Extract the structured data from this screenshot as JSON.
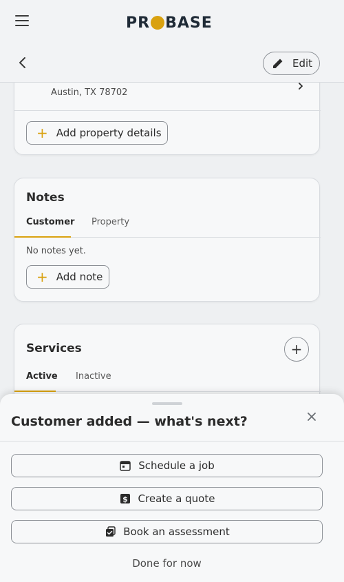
{
  "header": {
    "logo_left": "PR",
    "logo_right": "BASE",
    "menu_icon": "hamburger-menu-icon"
  },
  "subheader": {
    "back_icon": "chevron-left-icon",
    "edit_label": "Edit",
    "edit_icon": "pencil-icon"
  },
  "property": {
    "address_line2": "Austin, TX 78702",
    "add_details_label": "Add property details"
  },
  "notes": {
    "title": "Notes",
    "tabs": [
      {
        "label": "Customer",
        "active": true
      },
      {
        "label": "Property",
        "active": false
      }
    ],
    "empty_text": "No notes yet.",
    "add_label": "Add note"
  },
  "services": {
    "title": "Services",
    "tabs": [
      {
        "label": "Active",
        "active": true
      },
      {
        "label": "Inactive",
        "active": false
      }
    ]
  },
  "sheet": {
    "title": "Customer added — what's next?",
    "close_icon": "close-icon",
    "actions": [
      {
        "label": "Schedule a job",
        "icon": "calendar-icon"
      },
      {
        "label": "Create a quote",
        "icon": "dollar-document-icon"
      },
      {
        "label": "Book an assessment",
        "icon": "clipboard-check-icon"
      }
    ],
    "done_label": "Done for now"
  },
  "colors": {
    "accent": "#d9a10f",
    "text": "#2b2b2b",
    "border": "#8c9096",
    "background": "#eef0f2"
  }
}
